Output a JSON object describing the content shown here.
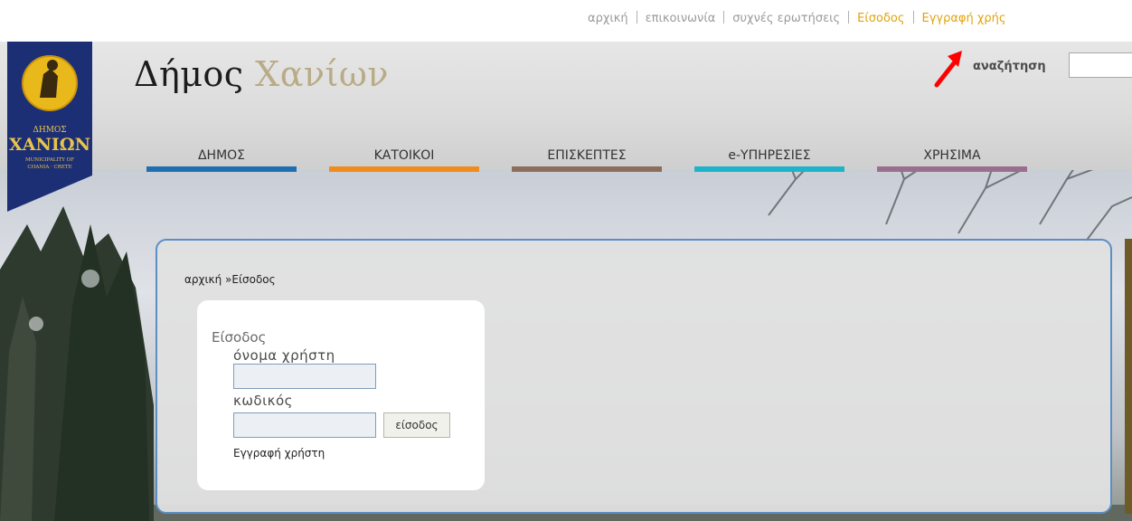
{
  "top_links": [
    {
      "label": "αρχική",
      "style": "plain"
    },
    {
      "label": "επικοινωνία",
      "style": "plain"
    },
    {
      "label": "συχνές ερωτήσεις",
      "style": "plain"
    },
    {
      "label": "Είσοδος",
      "style": "hl"
    },
    {
      "label": "Εγγραφή χρής",
      "style": "hl"
    }
  ],
  "header": {
    "title_dark": "Δήμος ",
    "title_light": "Χανίων",
    "search_label": "αναζήτηση",
    "search_value": ""
  },
  "crest": {
    "line1": "ΔΗΜΟΣ",
    "line2": "ΧΑΝΙΩΝ",
    "line3": "MUNICIPALITY OF",
    "line4": "CHANIA · CRETE"
  },
  "nav": [
    {
      "label": "ΔΗΜΟΣ",
      "color": "#1f6fb0"
    },
    {
      "label": "ΚΑΤΟΙΚΟΙ",
      "color": "#f08c1e"
    },
    {
      "label": "ΕΠΙΣΚΕΠΤΕΣ",
      "color": "#8b6f5c"
    },
    {
      "label": "e-ΥΠΗΡΕΣΙΕΣ",
      "color": "#1eb3c8"
    },
    {
      "label": "ΧΡΗΣΙΜΑ",
      "color": "#9a6e8e"
    }
  ],
  "breadcrumb": {
    "home": "αρχική",
    "separator": "»",
    "current": "Είσοδος"
  },
  "login": {
    "title": "Είσοδος",
    "username_label": "όνομα χρήστη",
    "username_value": "",
    "password_label": "κωδικός",
    "password_value": "",
    "submit_label": "είσοδος",
    "register_link": "Εγγραφή χρήστη"
  },
  "colors": {
    "accent_link": "#e2a30c",
    "panel_border": "#5b8fc2",
    "annotation_arrow": "#ff0000"
  }
}
